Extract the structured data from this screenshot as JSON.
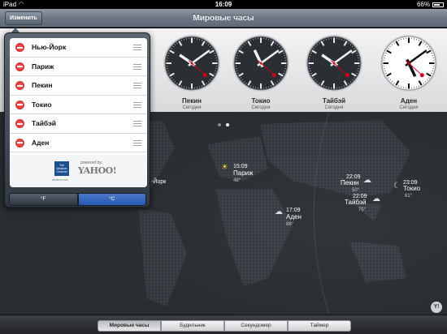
{
  "status_bar": {
    "carrier": "iPad",
    "time": "16:09",
    "battery": "66%"
  },
  "nav": {
    "title": "Мировые часы",
    "edit_label": "Изменить"
  },
  "clocks": [
    {
      "city": "Пекин",
      "day": "Сегодня",
      "hour": 22,
      "minute": 9
    },
    {
      "city": "Токио",
      "day": "Сегодня",
      "hour": 23,
      "minute": 9
    },
    {
      "city": "Тайбэй",
      "day": "Сегодня",
      "hour": 22,
      "minute": 9
    },
    {
      "city": "Аден",
      "day": "Сегодня",
      "hour": 17,
      "minute": 9
    }
  ],
  "popover": {
    "cities": [
      "Нью-Йорк",
      "Париж",
      "Пекин",
      "Токио",
      "Тайбэй",
      "Аден"
    ],
    "powered_by": "powered by:",
    "yahoo_logo": "YAHOO!",
    "twc_text": "The Weather Channel",
    "twc_url": "weather.com",
    "units": {
      "fahrenheit": "°F",
      "celsius": "°C",
      "selected": "celsius"
    }
  },
  "map": {
    "markers": [
      {
        "label": "-Йорк",
        "time": "",
        "temp": ""
      },
      {
        "label": "Париж",
        "time": "15:09",
        "temp": "48°",
        "icon": "sun-icon"
      },
      {
        "label": "Аден",
        "time": "17:09",
        "temp": "88°",
        "icon": "cloud-icon"
      },
      {
        "label": "Пекин",
        "time": "22:09",
        "temp": "50°",
        "icon": "cloud-icon"
      },
      {
        "label": "Тайбэй",
        "time": "22:09",
        "temp": "75°",
        "icon": "cloud-icon"
      },
      {
        "label": "Токио",
        "time": "23:09",
        "temp": "61°",
        "icon": "moon-icon"
      }
    ],
    "page_count": 2,
    "current_page": 2
  },
  "tabbar": {
    "tabs": [
      "Мировые часы",
      "Будильник",
      "Секундомер",
      "Таймер"
    ],
    "active": 0
  }
}
